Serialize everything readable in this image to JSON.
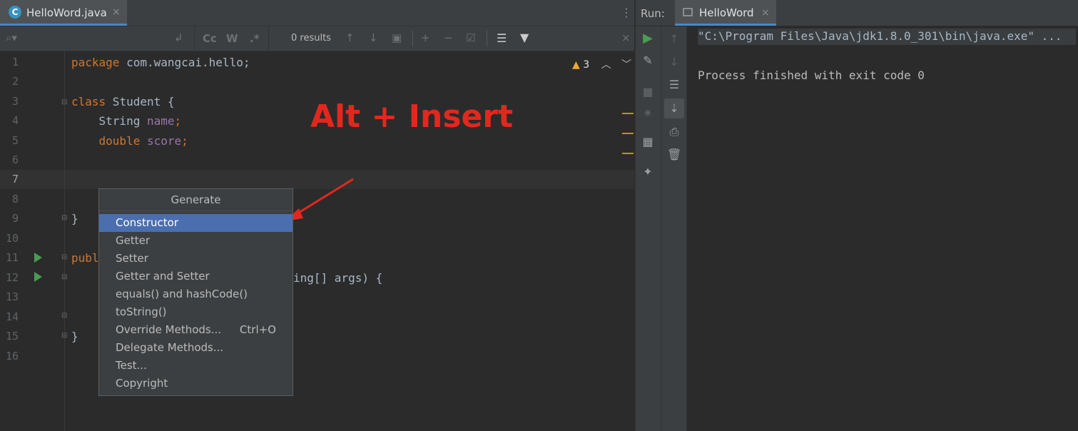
{
  "editor": {
    "tab": {
      "icon": "C",
      "label": "HelloWord.java",
      "close": "×",
      "more": "⋮"
    },
    "search": {
      "icon": "⌕▾",
      "results": "0 results",
      "btn_cc": "Cc",
      "btn_w": "W",
      "btn_regex": ".*"
    },
    "warnings": {
      "icon": "▲",
      "count": "3"
    },
    "line_numbers": [
      "1",
      "2",
      "3",
      "4",
      "5",
      "6",
      "7",
      "8",
      "9",
      "10",
      "11",
      "12",
      "13",
      "14",
      "15",
      "16"
    ],
    "code": {
      "l1_kw": "package",
      "l1_rest": " com.wangcai.hello;",
      "l3_kw": "class",
      "l3_rest": " Student {",
      "l4_type": "    String",
      "l4_field": " name",
      "l4_semi": ";",
      "l5_type": "    double",
      "l5_field": " score",
      "l5_semi": ";",
      "l9": "}",
      "l11_kw": "publi",
      "l12_rest": "ing[] args) {",
      "l15": "}"
    }
  },
  "annotation": {
    "text": "Alt + Insert",
    "color": "#e2281e"
  },
  "popup": {
    "title": "Generate",
    "items": [
      {
        "label": "Constructor",
        "shortcut": ""
      },
      {
        "label": "Getter",
        "shortcut": ""
      },
      {
        "label": "Setter",
        "shortcut": ""
      },
      {
        "label": "Getter and Setter",
        "shortcut": ""
      },
      {
        "label": "equals() and hashCode()",
        "shortcut": ""
      },
      {
        "label": "toString()",
        "shortcut": ""
      },
      {
        "label": "Override Methods...",
        "shortcut": "Ctrl+O"
      },
      {
        "label": "Delegate Methods...",
        "shortcut": ""
      },
      {
        "label": "Test...",
        "shortcut": ""
      },
      {
        "label": "Copyright",
        "shortcut": ""
      }
    ],
    "selected_index": 0,
    "selected_color": "#4b6eaf"
  },
  "run": {
    "label": "Run:",
    "tab_label": "HelloWord",
    "tab_close": "×",
    "console": {
      "cmd": "\"C:\\Program Files\\Java\\jdk1.8.0_301\\bin\\java.exe\" ...",
      "exit": "Process finished with exit code 0"
    }
  },
  "colors": {
    "keyword": "#cc7832",
    "field": "#9876aa",
    "background": "#2b2b2b",
    "panel": "#3c3f41"
  }
}
